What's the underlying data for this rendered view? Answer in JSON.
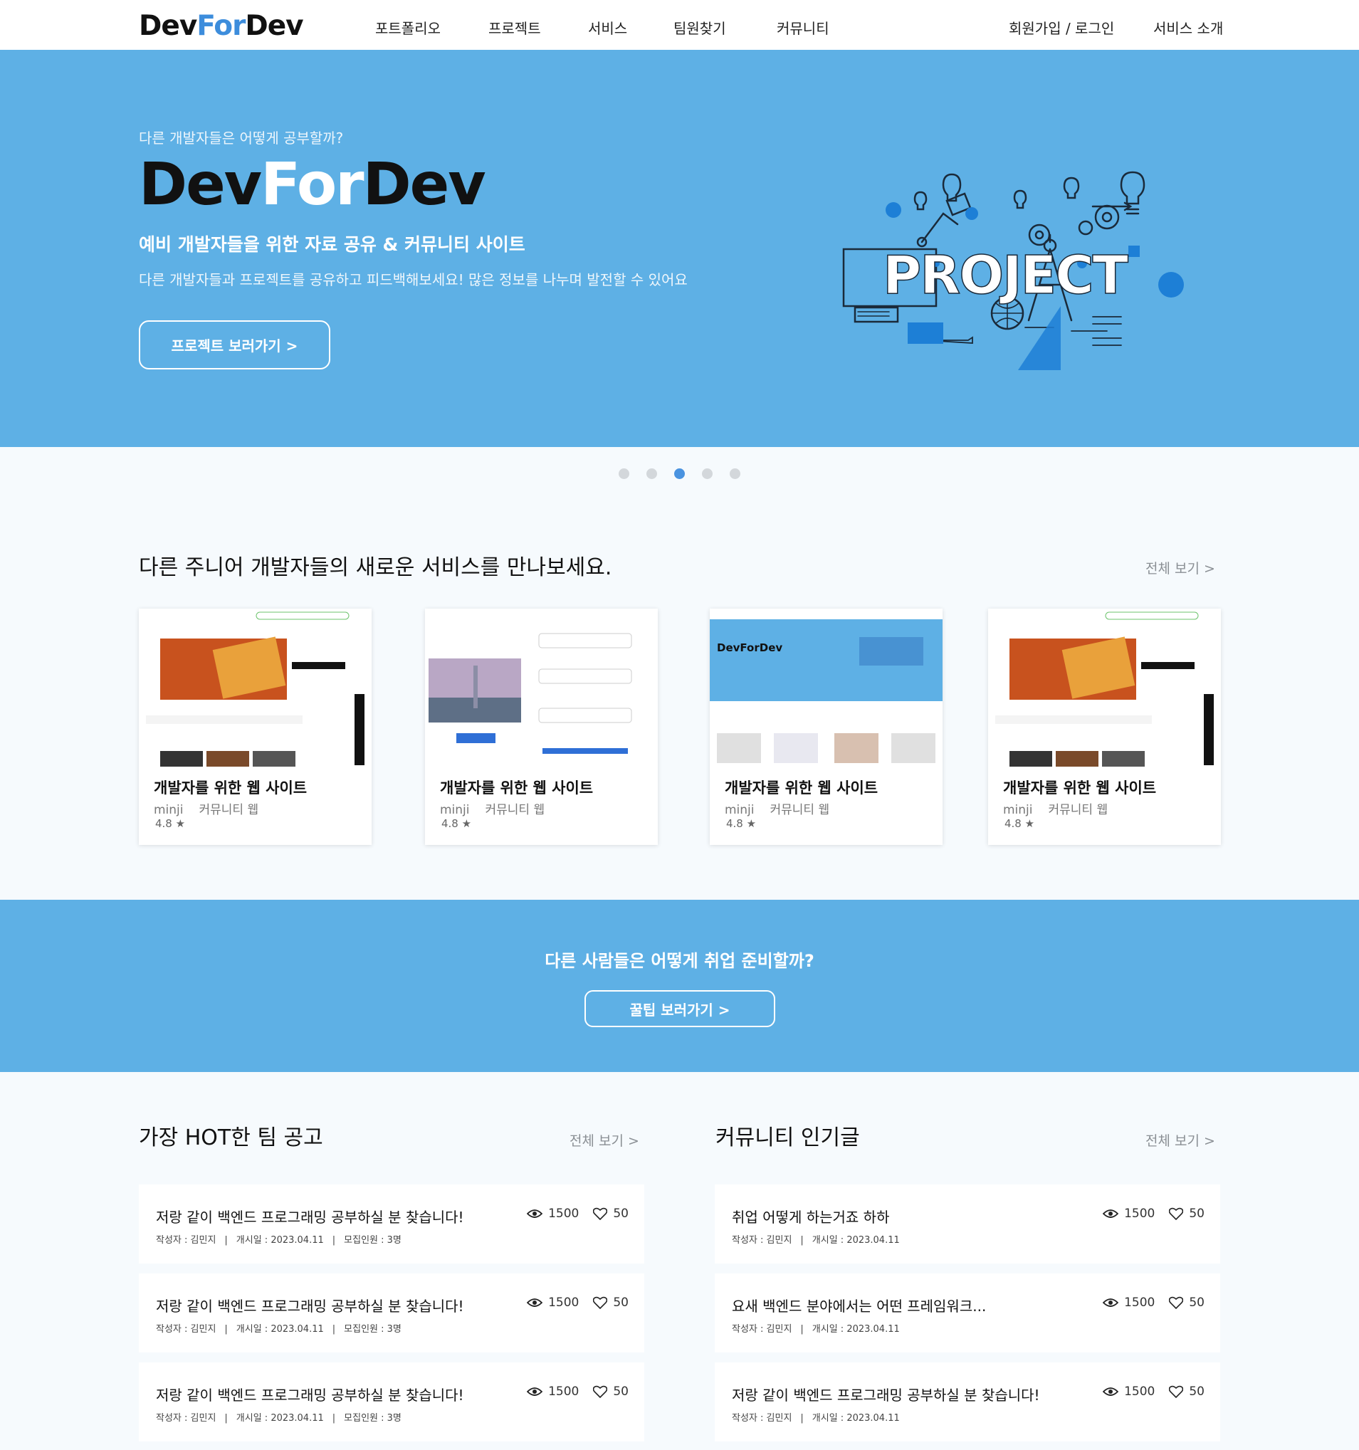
{
  "header": {
    "logo": {
      "dev1": "Dev",
      "for": "For",
      "dev2": "Dev"
    },
    "nav": [
      "포트폴리오",
      "프로젝트",
      "서비스",
      "팀원찾기",
      "커뮤니티"
    ],
    "auth": "회원가입 / 로그인",
    "about": "서비스 소개"
  },
  "hero": {
    "question": "다른 개발자들은 어떻게 공부할까?",
    "title": {
      "dev1": "Dev",
      "for": "For",
      "dev2": "Dev"
    },
    "subtitle": "예비 개발자들을 위한 자료 공유 & 커뮤니티 사이트",
    "description": "다른 개발자들과 프로젝트를 공유하고 피드백해보세요! 많은 정보를 나누며 발전할 수 있어요",
    "button": "프로젝트 보러가기 >",
    "illustration_text": "PROJECT",
    "slides": 5,
    "active_slide": 3
  },
  "services": {
    "title": "다른 주니어 개발자들의 새로운 서비스를 만나보세요.",
    "see_all": "전체 보기 >",
    "cards": [
      {
        "title": "개발자를 위한 웹 사이트",
        "author": "minji",
        "category": "커뮤니티 웹",
        "rating": "4.8 ★"
      },
      {
        "title": "개발자를 위한 웹 사이트",
        "author": "minji",
        "category": "커뮤니티 웹",
        "rating": "4.8 ★"
      },
      {
        "title": "개발자를 위한 웹 사이트",
        "author": "minji",
        "category": "커뮤니티 웹",
        "rating": "4.8 ★"
      },
      {
        "title": "개발자를 위한 웹 사이트",
        "author": "minji",
        "category": "커뮤니티 웹",
        "rating": "4.8 ★"
      }
    ]
  },
  "cta": {
    "text": "다른 사람들은 어떻게 취업 준비할까?",
    "button": "꿀팁 보러가기 >"
  },
  "hot_teams": {
    "title": "가장 HOT한 팀 공고",
    "see_all": "전체 보기 >",
    "posts": [
      {
        "title": "저랑 같이 백엔드 프로그래밍 공부하실 분 찾습니다!",
        "author": "작성자 : 김민지",
        "date": "개시일 : 2023.04.11",
        "recruit": "모집인원 : 3명",
        "views": "1500",
        "likes": "50"
      },
      {
        "title": "저랑 같이 백엔드 프로그래밍 공부하실 분 찾습니다!",
        "author": "작성자 : 김민지",
        "date": "개시일 : 2023.04.11",
        "recruit": "모집인원 : 3명",
        "views": "1500",
        "likes": "50"
      },
      {
        "title": "저랑 같이 백엔드 프로그래밍 공부하실 분 찾습니다!",
        "author": "작성자 : 김민지",
        "date": "개시일 : 2023.04.11",
        "recruit": "모집인원 : 3명",
        "views": "1500",
        "likes": "50"
      }
    ]
  },
  "community": {
    "title": "커뮤니티 인기글",
    "see_all": "전체 보기 >",
    "posts": [
      {
        "title": "취업 어떻게 하는거죠 하하",
        "author": "작성자 : 김민지",
        "date": "개시일 : 2023.04.11",
        "views": "1500",
        "likes": "50"
      },
      {
        "title": "요새 백엔드 분야에서는 어떤 프레임워크...",
        "author": "작성자 : 김민지",
        "date": "개시일 : 2023.04.11",
        "views": "1500",
        "likes": "50"
      },
      {
        "title": "저랑 같이 백엔드 프로그래밍 공부하실 분 찾습니다!",
        "author": "작성자 : 김민지",
        "date": "개시일 : 2023.04.11",
        "views": "1500",
        "likes": "50"
      }
    ]
  },
  "colors": {
    "accent": "#5eb0e5",
    "brand_blue": "#3d8ddc",
    "dot_active": "#4a93e0",
    "dot_inactive": "#d3d7db",
    "page_bg": "#f6fafd"
  }
}
